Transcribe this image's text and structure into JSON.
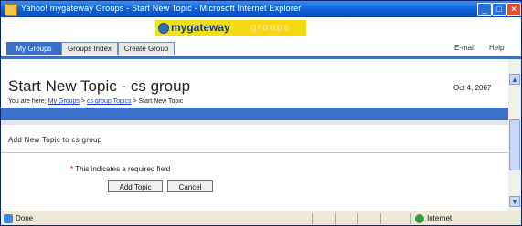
{
  "window": {
    "title": "Yahoo! mygateway Groups - Start New Topic - Microsoft Internet Explorer"
  },
  "header": {
    "logo_main": "mygateway",
    "logo_sub": "groups"
  },
  "tabs": [
    {
      "label": "My Groups"
    },
    {
      "label": "Groups Index"
    },
    {
      "label": "Create Group"
    }
  ],
  "links": {
    "mail": "E-mail",
    "help": "Help"
  },
  "page": {
    "title": "Start New Topic - cs group",
    "date": "Oct 4, 2007",
    "breadcrumb_prefix": "You are here:",
    "breadcrumb_1": "My Groups",
    "breadcrumb_2": "cs group Topics",
    "breadcrumb_current": "> Start New Topic",
    "section_heading": "Add New Topic to cs group",
    "notice": "* This indicates a required field",
    "notice_req": "*"
  },
  "buttons": {
    "add": "Add Topic",
    "cancel": "Cancel"
  },
  "statusbar": {
    "text": "Done",
    "zone": "Internet"
  }
}
